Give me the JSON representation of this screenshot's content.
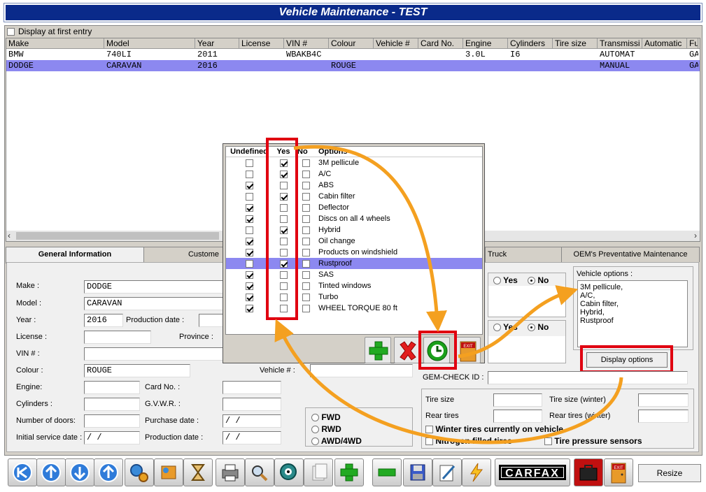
{
  "window": {
    "title": "Vehicle Maintenance - TEST"
  },
  "display_first": {
    "label": "Display at first entry",
    "checked": false
  },
  "grid": {
    "columns": [
      "Make",
      "Model",
      "Year",
      "License",
      "VIN #",
      "Colour",
      "Vehicle #",
      "Card No.",
      "Engine",
      "Cylinders",
      "Tire size",
      "Transmissi",
      "Automatic",
      "Fu"
    ],
    "rows": [
      [
        "BMW",
        "740LI",
        "2011",
        "",
        "WBAKB4C",
        "",
        "",
        "",
        "3.0L",
        "I6",
        "",
        "AUTOMAT",
        "",
        "GA"
      ],
      [
        "DODGE",
        "CARAVAN",
        "2016",
        "",
        "",
        "ROUGE",
        "",
        "",
        "",
        "",
        "",
        "MANUAL",
        "",
        "GA"
      ]
    ],
    "selected_row": 1
  },
  "tabs": [
    "General Information",
    "Custome",
    "Truck",
    "OEM's Preventative Maintenance"
  ],
  "form": {
    "make_label": "Make :",
    "make": "DODGE",
    "model_label": "Model :",
    "model": "CARAVAN",
    "year_label": "Year :",
    "year": "2016",
    "production_date_label": "Production date :",
    "license_label": "License :",
    "province_label": "Province :",
    "vin_label": "VIN # :",
    "colour_label": "Colour :",
    "colour": "ROUGE",
    "vehicle_no_label": "Vehicle # :",
    "engine_label": "Engine:",
    "card_no_label": "Card No. :",
    "cylinders_label": "Cylinders :",
    "gvwr_label": "G.V.W.R. :",
    "doors_label": "Number of doors:",
    "purchase_date_label": "Purchase date :",
    "purchase_date": " / /",
    "initial_service_label": "Initial service date :",
    "initial_service": " / /",
    "production_date2_label": "Production date :",
    "production_date2": " / /",
    "fwd": "FWD",
    "rwd": "RWD",
    "awd": "AWD/4WD",
    "yes": "Yes",
    "no": "No",
    "vehicle_options_label": "Vehicle options :",
    "vehicle_options": [
      "3M pellicule,",
      "A/C,",
      "Cabin filter,",
      "Hybrid,",
      "Rustproof"
    ],
    "display_options_button": "Display options",
    "gem_check_label": "GEM-CHECK ID :",
    "tire_size_label": "Tire size",
    "tire_size_winter_label": "Tire size (winter)",
    "rear_tires_label": "Rear tires",
    "rear_tires_winter_label": "Rear tires (winter)",
    "winter_tires_label": "Winter tires currently on vehicle",
    "nitrogen_label": "Nitrogen filled tires",
    "tpms_label": "Tire pressure sensors"
  },
  "options_popup": {
    "headers": [
      "Undefined",
      "Yes",
      "No",
      "Options"
    ],
    "rows": [
      {
        "name": "3M pellicule",
        "undefined": false,
        "yes": true,
        "no": false
      },
      {
        "name": "A/C",
        "undefined": false,
        "yes": true,
        "no": false
      },
      {
        "name": "ABS",
        "undefined": true,
        "yes": false,
        "no": false
      },
      {
        "name": "Cabin filter",
        "undefined": false,
        "yes": true,
        "no": false
      },
      {
        "name": "Deflector",
        "undefined": true,
        "yes": false,
        "no": false
      },
      {
        "name": "Discs on all 4 wheels",
        "undefined": true,
        "yes": false,
        "no": false
      },
      {
        "name": "Hybrid",
        "undefined": false,
        "yes": true,
        "no": false
      },
      {
        "name": "Oil change",
        "undefined": true,
        "yes": false,
        "no": false
      },
      {
        "name": "Products on windshield",
        "undefined": true,
        "yes": false,
        "no": false
      },
      {
        "name": "Rustproof",
        "undefined": false,
        "yes": true,
        "no": false
      },
      {
        "name": "SAS",
        "undefined": true,
        "yes": false,
        "no": false
      },
      {
        "name": "Tinted windows",
        "undefined": true,
        "yes": false,
        "no": false
      },
      {
        "name": "Turbo",
        "undefined": true,
        "yes": false,
        "no": false
      },
      {
        "name": "WHEEL TORQUE 80 ft",
        "undefined": true,
        "yes": false,
        "no": false
      }
    ],
    "selected_row": 9,
    "exit_label": "EXIT"
  },
  "toolbar": {
    "carfax": "CARFAX",
    "exit": "EXIT",
    "resize": "Resize"
  },
  "colors": {
    "title_bg": "#0a2a8a",
    "selection": "#8c88f0",
    "highlight": "#e00010",
    "arrow": "#f4a020"
  }
}
